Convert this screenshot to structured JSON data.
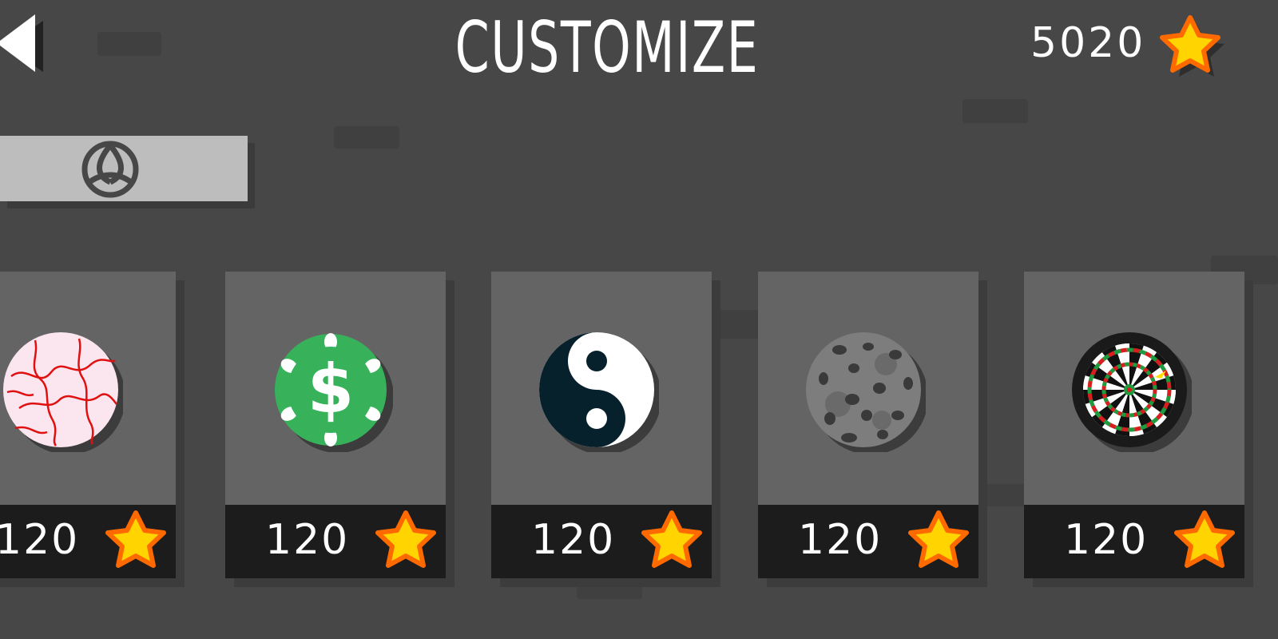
{
  "header": {
    "title": "CUSTOMIZE",
    "back_icon": "back-arrow-icon",
    "coins": "5020",
    "currency_icon": "star-icon"
  },
  "category": {
    "selected_icon": "triquetra-icon"
  },
  "shop": {
    "items": [
      {
        "skin": "red-veins-ball-icon",
        "price": "120"
      },
      {
        "skin": "dollar-chip-ball-icon",
        "price": "120"
      },
      {
        "skin": "yin-yang-ball-icon",
        "price": "120"
      },
      {
        "skin": "cookie-ball-icon",
        "price": "120"
      },
      {
        "skin": "dartboard-ball-icon",
        "price": "120"
      }
    ]
  },
  "colors": {
    "background": "#474747",
    "card": "#646464",
    "price_bar": "#1c1c1c",
    "star_fill": "#ffd400",
    "star_outline": "#ff6a00",
    "category_tab": "#bdbdbd"
  }
}
